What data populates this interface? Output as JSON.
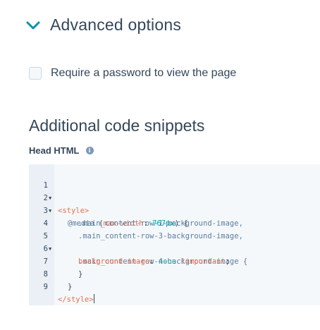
{
  "advanced": {
    "label": "Advanced options",
    "icon": "chevron-down-icon",
    "accent": "#0091ae"
  },
  "password": {
    "label": "Require a password to view the page",
    "checked": false
  },
  "snippets": {
    "title": "Additional code snippets"
  },
  "head_html": {
    "label": "Head HTML",
    "icon": "info-icon"
  },
  "editor": {
    "line_numbers": [
      "1",
      "2",
      "3",
      "4",
      "5",
      "6",
      "7",
      "8",
      "9"
    ],
    "code": {
      "l1": "<style>",
      "l2_at": "@media",
      "l2_open": " (",
      "l2_prop": "max-width",
      "l2_colon": ": ",
      "l2_num": "767px",
      "l2_close": ") {",
      "l3": ".main_content-row-1-background-image,",
      "l4": ".main_content-row-3-background-image,",
      "l5": ".main_content-row-4-background-image {",
      "l6_prop": "background-image",
      "l6_colon": ": ",
      "l6_val": "none",
      "l6_imp": "!important",
      "l6_end": ";",
      "l7": "}",
      "l8": "}",
      "l9": "</style>"
    }
  }
}
